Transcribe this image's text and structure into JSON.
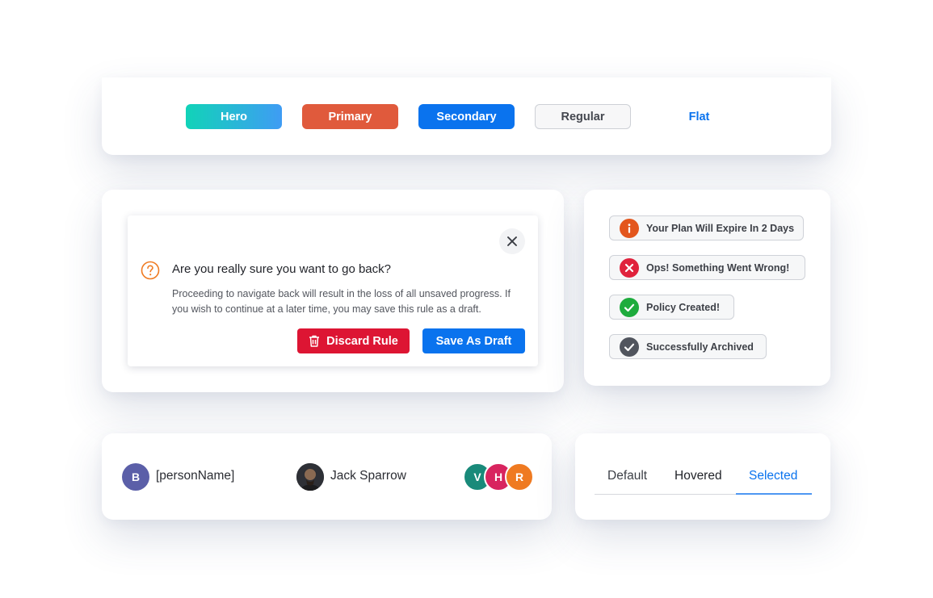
{
  "buttons": {
    "hero": "Hero",
    "primary": "Primary",
    "secondary": "Secondary",
    "regular": "Regular",
    "flat": "Flat"
  },
  "dialog": {
    "title": "Are you really sure you want to go back?",
    "body": "Proceeding to navigate back will result in the loss of all unsaved progress. If you wish to continue at a later time, you may save this rule as a draft.",
    "discard_label": "Discard Rule",
    "save_label": "Save As Draft",
    "icons": {
      "close": "close-icon",
      "question": "question-circle-icon",
      "trash": "trash-icon"
    }
  },
  "toasts": [
    {
      "text": "Your Plan Will Expire In 2 Days",
      "icon": "info-icon",
      "color": "#e3561d"
    },
    {
      "text": "Ops! Something Went Wrong!",
      "icon": "error-x-icon",
      "color": "#e0223c"
    },
    {
      "text": "Policy Created!",
      "icon": "check-circle-icon",
      "color": "#1eac3d"
    },
    {
      "text": "Successfully Archived",
      "icon": "check-circle-icon",
      "color": "#51555e"
    }
  ],
  "avatars": {
    "single": {
      "initial": "B",
      "name": "[personName]",
      "color": "#5b5fa8"
    },
    "photo": {
      "name": "Jack Sparrow"
    },
    "group": [
      {
        "initial": "V",
        "color": "#198a7a"
      },
      {
        "initial": "H",
        "color": "#d8245f"
      },
      {
        "initial": "R",
        "color": "#ef7a21"
      }
    ]
  },
  "tabs": {
    "items": [
      "Default",
      "Hovered",
      "Selected"
    ],
    "selected": "Selected"
  },
  "colors": {
    "accent": "#0a73ee",
    "primary": "#e05a3c",
    "danger": "#dd1533"
  }
}
